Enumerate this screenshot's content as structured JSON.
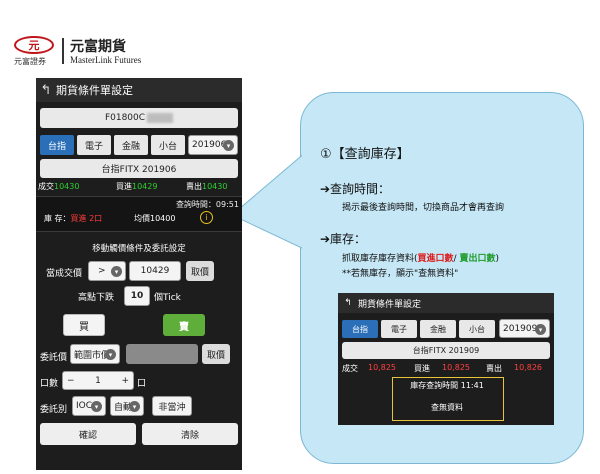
{
  "logo": {
    "mark": "元",
    "sub": "元富證券",
    "name": "元富期貨",
    "en": "MasterLink Futures"
  },
  "phone": {
    "title": "期貨條件單設定",
    "account": "F01800C",
    "tabs": [
      "台指",
      "電子",
      "金融",
      "小台"
    ],
    "month": "201906",
    "product": "台指FITX 201906",
    "quote": {
      "deal_label": "成交",
      "deal": "10430",
      "bid_label": "買進",
      "bid": "10429",
      "ask_label": "賣出",
      "ask": "10430"
    },
    "inventory": {
      "time": "查詢時間：09:51",
      "label": "庫 存：",
      "side": "買進 2口",
      "avg": "均價10400",
      "info": "i"
    },
    "section_title": "移動觸價條件及委託設定",
    "cond": {
      "label": "當成交價",
      "op": ">",
      "price": "10429",
      "cancel": "取價"
    },
    "high": {
      "label": "高點下跌",
      "value": "10",
      "unit": "個Tick"
    },
    "buy": "買",
    "sell": "賣",
    "entrust": {
      "label": "委託價",
      "select": "範圍市價",
      "cancel": "取價"
    },
    "qty": {
      "label": "口數",
      "minus": "−",
      "value": "1",
      "plus": "+",
      "unit": "口"
    },
    "type": {
      "label": "委託別",
      "ioc": "IOC",
      "auto": "自動",
      "no_flush": "非當沖"
    },
    "confirm": "確認",
    "clear": "清除"
  },
  "bubble": {
    "title": "①【查詢庫存】",
    "h1": "➔查詢時間：",
    "t1": "揭示最後查詢時間，切換商品才會再查詢",
    "h2": "➔庫存：",
    "t2a": "抓取庫存庫存資料(",
    "t2_buy": "買進口數",
    "t2_sep": "/ ",
    "t2_sell": "賣出口數",
    "t2b": ")",
    "t3": "**若無庫存，顯示\"查無資料\""
  },
  "mini": {
    "title": "期貨條件單設定",
    "tabs": [
      "台指",
      "電子",
      "金融",
      "小台"
    ],
    "month": "201909",
    "product": "台指FITX 201909",
    "deal_label": "成交",
    "deal": "10,825",
    "bid_label": "買進",
    "bid": "10,825",
    "ask_label": "賣出",
    "ask": "10,826",
    "stock_time": "庫存查詢時間 11:41",
    "stock_none": "查無資料"
  },
  "colors": {
    "brand_red": "#c0161b",
    "tab_blue": "#2a6fb8",
    "bubble_bg": "#c5e7f6",
    "up_green": "#2ed12e",
    "sell_green": "#5fae3c",
    "highlight_yellow": "#e7c43a"
  }
}
